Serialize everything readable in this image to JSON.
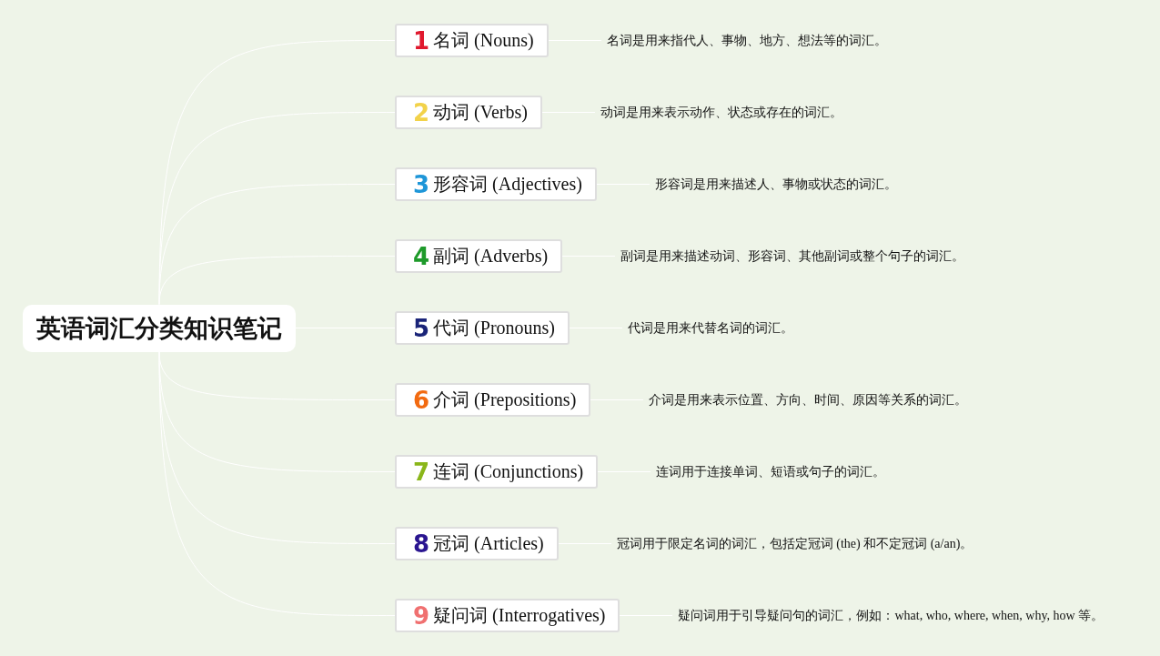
{
  "root": {
    "title": "英语词汇分类知识笔记"
  },
  "branches": [
    {
      "number": "1",
      "color": "#e0192e",
      "label": "名词 (Nouns)",
      "description": "名词是用来指代人、事物、地方、想法等的词汇。"
    },
    {
      "number": "2",
      "color": "#f2d24a",
      "label": "动词 (Verbs)",
      "description": "动词是用来表示动作、状态或存在的词汇。"
    },
    {
      "number": "3",
      "color": "#1e96d8",
      "label": "形容词 (Adjectives)",
      "description": "形容词是用来描述人、事物或状态的词汇。"
    },
    {
      "number": "4",
      "color": "#1e9a2a",
      "label": "副词 (Adverbs)",
      "description": "副词是用来描述动词、形容词、其他副词或整个句子的词汇。"
    },
    {
      "number": "5",
      "color": "#1a2478",
      "label": "代词 (Pronouns)",
      "description": "代词是用来代替名词的词汇。"
    },
    {
      "number": "6",
      "color": "#f26a10",
      "label": "介词 (Prepositions)",
      "description": "介词是用来表示位置、方向、时间、原因等关系的词汇。"
    },
    {
      "number": "7",
      "color": "#8ab61a",
      "label": "连词 (Conjunctions)",
      "description": "连词用于连接单词、短语或句子的词汇。"
    },
    {
      "number": "8",
      "color": "#2a1590",
      "label": "冠词 (Articles)",
      "description": "冠词用于限定名词的词汇，包括定冠词 (the) 和不定冠词 (a/an)。"
    },
    {
      "number": "9",
      "color": "#f07070",
      "label": "疑问词 (Interrogatives)",
      "description": "疑问词用于引导疑问句的词汇，例如：what, who, where, when, why, how 等。"
    }
  ]
}
